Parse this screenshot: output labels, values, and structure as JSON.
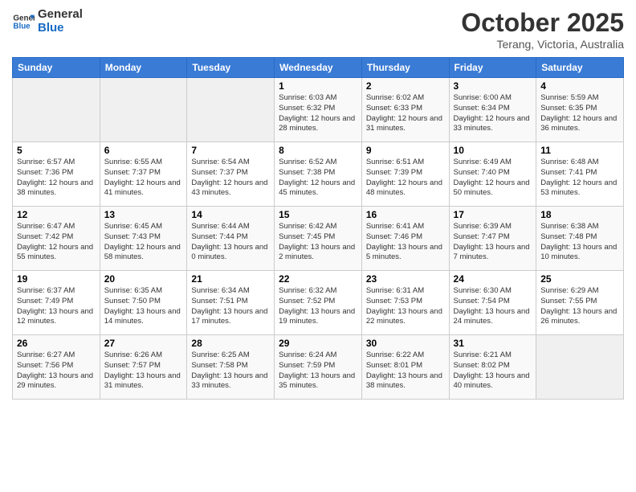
{
  "header": {
    "logo_line1": "General",
    "logo_line2": "Blue",
    "month": "October 2025",
    "location": "Terang, Victoria, Australia"
  },
  "days_of_week": [
    "Sunday",
    "Monday",
    "Tuesday",
    "Wednesday",
    "Thursday",
    "Friday",
    "Saturday"
  ],
  "weeks": [
    [
      {
        "day": "",
        "info": ""
      },
      {
        "day": "",
        "info": ""
      },
      {
        "day": "",
        "info": ""
      },
      {
        "day": "1",
        "info": "Sunrise: 6:03 AM\nSunset: 6:32 PM\nDaylight: 12 hours\nand 28 minutes."
      },
      {
        "day": "2",
        "info": "Sunrise: 6:02 AM\nSunset: 6:33 PM\nDaylight: 12 hours\nand 31 minutes."
      },
      {
        "day": "3",
        "info": "Sunrise: 6:00 AM\nSunset: 6:34 PM\nDaylight: 12 hours\nand 33 minutes."
      },
      {
        "day": "4",
        "info": "Sunrise: 5:59 AM\nSunset: 6:35 PM\nDaylight: 12 hours\nand 36 minutes."
      }
    ],
    [
      {
        "day": "5",
        "info": "Sunrise: 6:57 AM\nSunset: 7:36 PM\nDaylight: 12 hours\nand 38 minutes."
      },
      {
        "day": "6",
        "info": "Sunrise: 6:55 AM\nSunset: 7:37 PM\nDaylight: 12 hours\nand 41 minutes."
      },
      {
        "day": "7",
        "info": "Sunrise: 6:54 AM\nSunset: 7:37 PM\nDaylight: 12 hours\nand 43 minutes."
      },
      {
        "day": "8",
        "info": "Sunrise: 6:52 AM\nSunset: 7:38 PM\nDaylight: 12 hours\nand 45 minutes."
      },
      {
        "day": "9",
        "info": "Sunrise: 6:51 AM\nSunset: 7:39 PM\nDaylight: 12 hours\nand 48 minutes."
      },
      {
        "day": "10",
        "info": "Sunrise: 6:49 AM\nSunset: 7:40 PM\nDaylight: 12 hours\nand 50 minutes."
      },
      {
        "day": "11",
        "info": "Sunrise: 6:48 AM\nSunset: 7:41 PM\nDaylight: 12 hours\nand 53 minutes."
      }
    ],
    [
      {
        "day": "12",
        "info": "Sunrise: 6:47 AM\nSunset: 7:42 PM\nDaylight: 12 hours\nand 55 minutes."
      },
      {
        "day": "13",
        "info": "Sunrise: 6:45 AM\nSunset: 7:43 PM\nDaylight: 12 hours\nand 58 minutes."
      },
      {
        "day": "14",
        "info": "Sunrise: 6:44 AM\nSunset: 7:44 PM\nDaylight: 13 hours\nand 0 minutes."
      },
      {
        "day": "15",
        "info": "Sunrise: 6:42 AM\nSunset: 7:45 PM\nDaylight: 13 hours\nand 2 minutes."
      },
      {
        "day": "16",
        "info": "Sunrise: 6:41 AM\nSunset: 7:46 PM\nDaylight: 13 hours\nand 5 minutes."
      },
      {
        "day": "17",
        "info": "Sunrise: 6:39 AM\nSunset: 7:47 PM\nDaylight: 13 hours\nand 7 minutes."
      },
      {
        "day": "18",
        "info": "Sunrise: 6:38 AM\nSunset: 7:48 PM\nDaylight: 13 hours\nand 10 minutes."
      }
    ],
    [
      {
        "day": "19",
        "info": "Sunrise: 6:37 AM\nSunset: 7:49 PM\nDaylight: 13 hours\nand 12 minutes."
      },
      {
        "day": "20",
        "info": "Sunrise: 6:35 AM\nSunset: 7:50 PM\nDaylight: 13 hours\nand 14 minutes."
      },
      {
        "day": "21",
        "info": "Sunrise: 6:34 AM\nSunset: 7:51 PM\nDaylight: 13 hours\nand 17 minutes."
      },
      {
        "day": "22",
        "info": "Sunrise: 6:32 AM\nSunset: 7:52 PM\nDaylight: 13 hours\nand 19 minutes."
      },
      {
        "day": "23",
        "info": "Sunrise: 6:31 AM\nSunset: 7:53 PM\nDaylight: 13 hours\nand 22 minutes."
      },
      {
        "day": "24",
        "info": "Sunrise: 6:30 AM\nSunset: 7:54 PM\nDaylight: 13 hours\nand 24 minutes."
      },
      {
        "day": "25",
        "info": "Sunrise: 6:29 AM\nSunset: 7:55 PM\nDaylight: 13 hours\nand 26 minutes."
      }
    ],
    [
      {
        "day": "26",
        "info": "Sunrise: 6:27 AM\nSunset: 7:56 PM\nDaylight: 13 hours\nand 29 minutes."
      },
      {
        "day": "27",
        "info": "Sunrise: 6:26 AM\nSunset: 7:57 PM\nDaylight: 13 hours\nand 31 minutes."
      },
      {
        "day": "28",
        "info": "Sunrise: 6:25 AM\nSunset: 7:58 PM\nDaylight: 13 hours\nand 33 minutes."
      },
      {
        "day": "29",
        "info": "Sunrise: 6:24 AM\nSunset: 7:59 PM\nDaylight: 13 hours\nand 35 minutes."
      },
      {
        "day": "30",
        "info": "Sunrise: 6:22 AM\nSunset: 8:01 PM\nDaylight: 13 hours\nand 38 minutes."
      },
      {
        "day": "31",
        "info": "Sunrise: 6:21 AM\nSunset: 8:02 PM\nDaylight: 13 hours\nand 40 minutes."
      },
      {
        "day": "",
        "info": ""
      }
    ]
  ]
}
